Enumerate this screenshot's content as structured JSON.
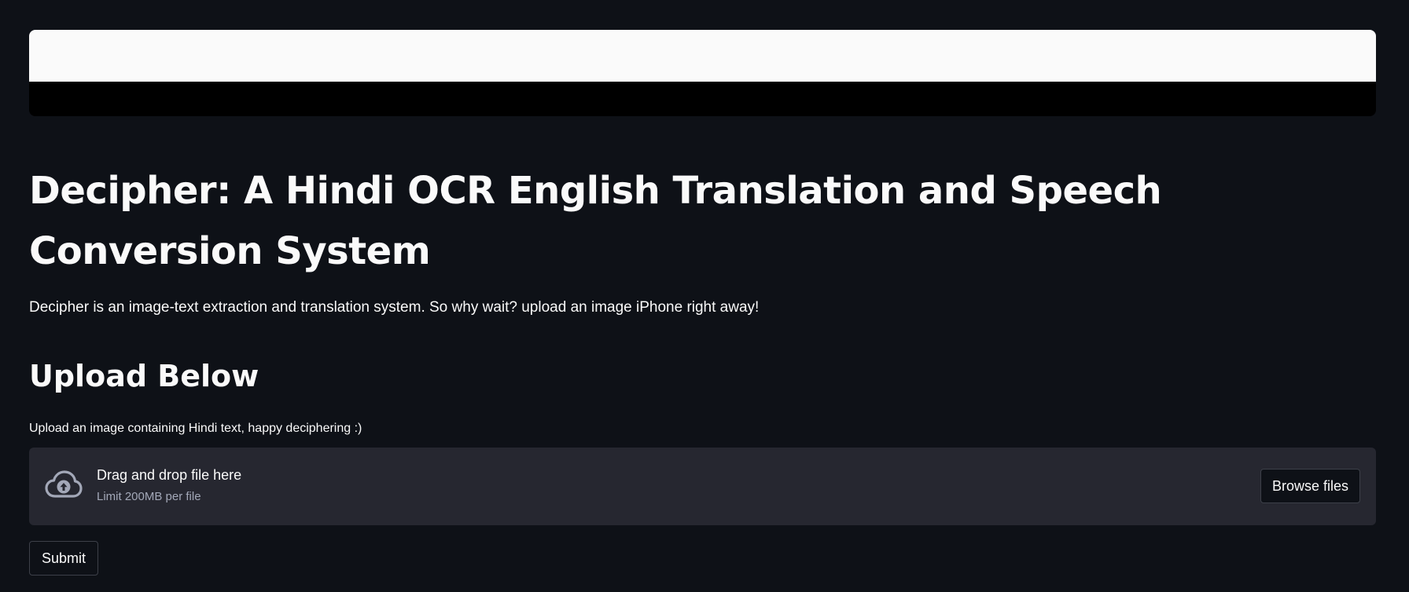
{
  "header": {
    "title": "Decipher: A Hindi OCR English Translation and Speech Conversion System",
    "description": "Decipher is an image-text extraction and translation system. So why wait? upload an image iPhone right away!"
  },
  "upload_section": {
    "subheader": "Upload Below",
    "label": "Upload an image containing Hindi text, happy deciphering :)",
    "dropzone": {
      "icon": "cloud-upload-icon",
      "main_text": "Drag and drop file here",
      "limit_text": "Limit 200MB per file",
      "browse_label": "Browse files"
    },
    "submit_label": "Submit"
  },
  "colors": {
    "background": "#0e1117",
    "text": "#fafafa",
    "dropzone": "#262730",
    "muted_text": "#a3a8b8",
    "banner_top": "#fafafa",
    "banner_bottom": "#000000"
  }
}
